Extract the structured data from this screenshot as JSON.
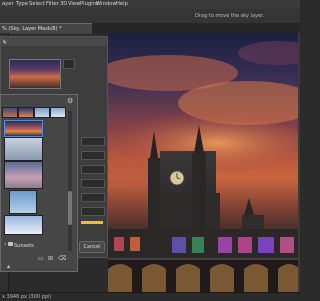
{
  "menubar": {
    "items": [
      "ayer",
      "Type",
      "Select",
      "Filter",
      "3D",
      "View",
      "Plugins",
      "Window",
      "Help"
    ]
  },
  "options_bar": {
    "hint": "Drag to move the sky layer."
  },
  "document_tab": {
    "label": "% (Sky, Layer Mask/8) *"
  },
  "dialog": {
    "title": "t",
    "close_icon": "close-icon",
    "cancel_label": "Cancel"
  },
  "picker": {
    "folder_label": "Sunsets",
    "gear_icon": "gear-icon",
    "folder_icon": "folder-icon",
    "new_icon": "new-icon",
    "delete_icon": "trash-icon"
  },
  "status_bar": {
    "text": "x 3946 px (300 ppi)"
  },
  "colors": {
    "accent": "#e8853a",
    "panel": "#3d3d3d",
    "popup": "#464646"
  }
}
